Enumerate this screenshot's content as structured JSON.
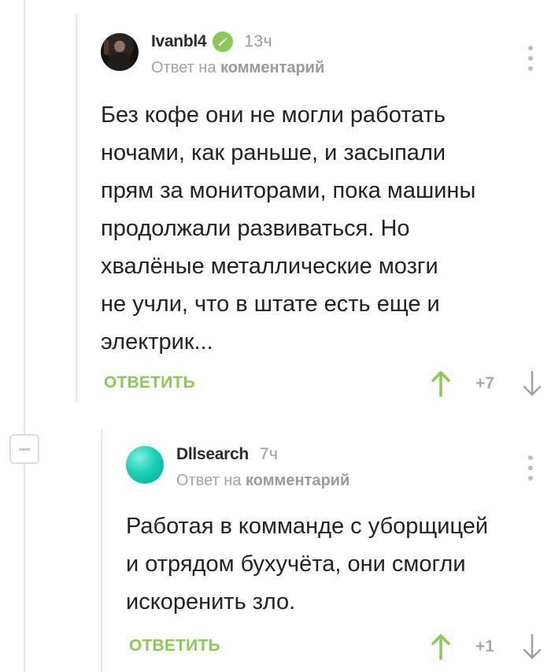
{
  "comments": [
    {
      "author": "Ivanbl4",
      "verified": true,
      "time": "13ч",
      "reply_prefix": "Ответ на",
      "reply_target": "комментарий",
      "text_lines": [
        "Без кофе они не могли работать",
        "ночами, как раньше, и засыпали",
        "прям за мониторами, пока машины",
        "продолжали развиваться. Но",
        "хвалёные металлические мозги",
        "не учли, что в штате есть еще и",
        "электрик..."
      ],
      "reply_label": "ОТВЕТИТЬ",
      "score": "+7",
      "avatar_icon": "user-avatar-photo"
    },
    {
      "author": "Dllsearch",
      "verified": false,
      "time": "7ч",
      "reply_prefix": "Ответ на",
      "reply_target": "комментарий",
      "text_lines": [
        "Работая в комманде с уборщицей",
        "и отрядом бухучёта, они смогли",
        "искоренить зло."
      ],
      "reply_label": "ОТВЕТИТЬ",
      "score": "+1",
      "avatar_icon": "teal-circle-avatar"
    }
  ],
  "colors": {
    "accent_green": "#8ac858",
    "score_gray": "#a9a9a9",
    "thread_line": "#e6e6e6"
  },
  "icons": {
    "vote_up": "arrow-up-icon",
    "vote_down": "arrow-down-icon",
    "more": "more-vertical-icon",
    "collapse": "minus-icon",
    "verified": "checkmark-badge-icon"
  }
}
